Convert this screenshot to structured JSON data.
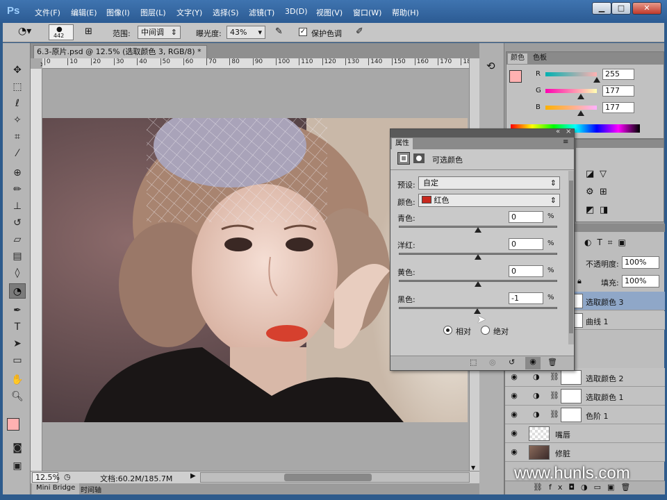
{
  "app": {
    "logo": "Ps",
    "menu": [
      "文件(F)",
      "编辑(E)",
      "图像(I)",
      "图层(L)",
      "文字(Y)",
      "选择(S)",
      "滤镜(T)",
      "3D(D)",
      "视图(V)",
      "窗口(W)",
      "帮助(H)"
    ],
    "window_buttons": {
      "minimize": "▁",
      "maximize": "□",
      "close": "✕"
    }
  },
  "options": {
    "brush_size": "442",
    "range_label": "范围:",
    "range_value": "中间调",
    "exposure_label": "曝光度:",
    "exposure_value": "43%",
    "protect_label": "保护色调",
    "protect_checked": true
  },
  "document": {
    "tab_title": "6.3-原片.psd @ 12.5% (选取颜色 3, RGB/8) *",
    "ruler_numbers": [
      "0",
      "10",
      "20",
      "30",
      "40",
      "50",
      "60",
      "70",
      "80",
      "90",
      "100",
      "110",
      "120",
      "130",
      "140",
      "150",
      "160",
      "170",
      "18"
    ],
    "zoom": "12.5%",
    "doc_info": "文档:60.2M/185.7M"
  },
  "bottom_tabs": [
    "Mini Bridge",
    "时间轴"
  ],
  "color_panel": {
    "tabs": [
      "颜色",
      "色板"
    ],
    "channels": [
      {
        "label": "R",
        "value": "255",
        "level": 1.0
      },
      {
        "label": "G",
        "value": "177",
        "level": 0.694
      },
      {
        "label": "B",
        "value": "177",
        "level": 0.694
      }
    ],
    "foreground": "#ffb1b1"
  },
  "properties": {
    "tab": "属性",
    "title": "可选颜色",
    "preset_label": "预设:",
    "preset_value": "自定",
    "color_label": "颜色:",
    "color_value": "红色",
    "color_swatch": "#c8281e",
    "sliders": [
      {
        "label": "青色:",
        "value": "0",
        "level": 0.5
      },
      {
        "label": "洋红:",
        "value": "0",
        "level": 0.5
      },
      {
        "label": "黄色:",
        "value": "0",
        "level": 0.5
      },
      {
        "label": "黑色:",
        "value": "-1",
        "level": 0.495
      }
    ],
    "percent": "%",
    "mode_relative": "相对",
    "mode_absolute": "绝对",
    "mode_selected": "relative"
  },
  "layers": {
    "opacity_label": "不透明度:",
    "opacity_value": "100%",
    "fill_label": "填充:",
    "fill_value": "100%",
    "items": [
      {
        "name": "选取颜色 3",
        "selected": true
      },
      {
        "name": "曲线 1",
        "selected": false
      },
      {
        "name": "选取颜色 2",
        "selected": false
      },
      {
        "name": "选取颜色 1",
        "selected": false
      },
      {
        "name": "色阶 1",
        "selected": false
      },
      {
        "name": "嘴唇",
        "selected": false
      },
      {
        "name": "修脏",
        "selected": false
      }
    ]
  },
  "watermark": "www.hunls.com"
}
